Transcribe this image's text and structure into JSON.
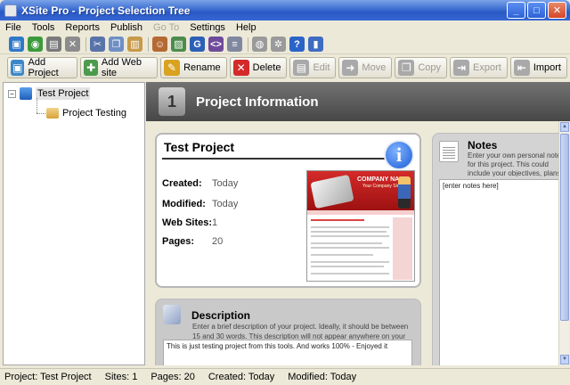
{
  "window": {
    "title": "XSite Pro - Project Selection Tree",
    "controls": {
      "minimize": "_",
      "maximize": "□",
      "close": "✕"
    }
  },
  "menu": [
    "File",
    "Tools",
    "Reports",
    "Publish",
    "Go To",
    "Settings",
    "Help"
  ],
  "menu_disabled": [
    "Go To"
  ],
  "toolbar_small": [
    {
      "name": "new-project-icon",
      "glyph": "▣",
      "color": "#2f78c9"
    },
    {
      "name": "open-project-icon",
      "glyph": "◉",
      "color": "#3c9a3c"
    },
    {
      "name": "save-icon",
      "glyph": "▤",
      "color": "#7a7a7a"
    },
    {
      "name": "cancel-icon",
      "glyph": "✕",
      "color": "#8c8c8c"
    },
    {
      "name": "cut-icon",
      "glyph": "✂",
      "color": "#5873a8"
    },
    {
      "name": "copy-icon",
      "glyph": "❐",
      "color": "#6f8ec4"
    },
    {
      "name": "paste-icon",
      "glyph": "▥",
      "color": "#c79a4a"
    },
    {
      "name": "users-icon",
      "glyph": "☺",
      "color": "#b56a33"
    },
    {
      "name": "image-icon",
      "glyph": "▨",
      "color": "#4c8c4c"
    },
    {
      "name": "google-icon",
      "glyph": "G",
      "color": "#2c5fb6"
    },
    {
      "name": "html-icon",
      "glyph": "<>",
      "color": "#6f4a9a"
    },
    {
      "name": "document-icon",
      "glyph": "≡",
      "color": "#8088a0"
    },
    {
      "name": "globe-icon",
      "glyph": "◍",
      "color": "#9a9a9a"
    },
    {
      "name": "gear-icon",
      "glyph": "✲",
      "color": "#9a9a9a"
    },
    {
      "name": "help-icon",
      "glyph": "?",
      "color": "#2a64c9"
    },
    {
      "name": "book-icon",
      "glyph": "▮",
      "color": "#3f6cc2"
    }
  ],
  "toolbar_big": [
    {
      "name": "add-project-button",
      "label": "Add Project",
      "glyph": "▣",
      "color": "#3c87c8",
      "disabled": false
    },
    {
      "name": "add-web-site-button",
      "label": "Add Web site",
      "glyph": "✚",
      "color": "#4c9a4c",
      "disabled": false
    },
    {
      "name": "rename-button",
      "label": "Rename",
      "glyph": "✎",
      "color": "#d9a21f",
      "disabled": false
    },
    {
      "name": "delete-button",
      "label": "Delete",
      "glyph": "✕",
      "color": "#d42a2a",
      "disabled": false
    },
    {
      "name": "edit-button",
      "label": "Edit",
      "glyph": "▤",
      "color": "#a9a9a9",
      "disabled": true
    },
    {
      "name": "move-button",
      "label": "Move",
      "glyph": "➜",
      "color": "#a9a9a9",
      "disabled": true
    },
    {
      "name": "copy-button",
      "label": "Copy",
      "glyph": "❐",
      "color": "#a9a9a9",
      "disabled": true
    },
    {
      "name": "export-button",
      "label": "Export",
      "glyph": "⇥",
      "color": "#a9a9a9",
      "disabled": true
    },
    {
      "name": "import-button",
      "label": "Import",
      "glyph": "⇤",
      "color": "#a9a9a9",
      "disabled": false
    }
  ],
  "tree": {
    "root": "Test Project",
    "child": "Project Testing",
    "expander": "−"
  },
  "header": {
    "title": "Project Information",
    "icon_glyph": "1"
  },
  "project": {
    "name": "Test Project",
    "info_glyph": "i",
    "created_label": "Created:",
    "created_value": "Today",
    "modified_label": "Modified:",
    "modified_value": "Today",
    "websites_label": "Web Sites:",
    "websites_value": "1",
    "pages_label": "Pages:",
    "pages_value": "20"
  },
  "thumbnail": {
    "company_name": "COMPANY NAME",
    "slogan": "Your Company Slogan"
  },
  "description": {
    "title": "Description",
    "help": "Enter a brief description of your project. Ideally, it should be between 15 and 30 words. This description will not appear anywhere on your Web sites.",
    "value": "This is just testing project from this tools. And works 100% - Enjoyed it"
  },
  "notes": {
    "title": "Notes",
    "help": "Enter your own personal notes for this project. This could include your objectives, plans, items you want to include, todos, etc.",
    "value": "[enter notes here]"
  },
  "status": {
    "project": "Project: Test Project",
    "sites": "Sites: 1",
    "pages": "Pages: 20",
    "created": "Created: Today",
    "modified": "Modified: Today"
  }
}
